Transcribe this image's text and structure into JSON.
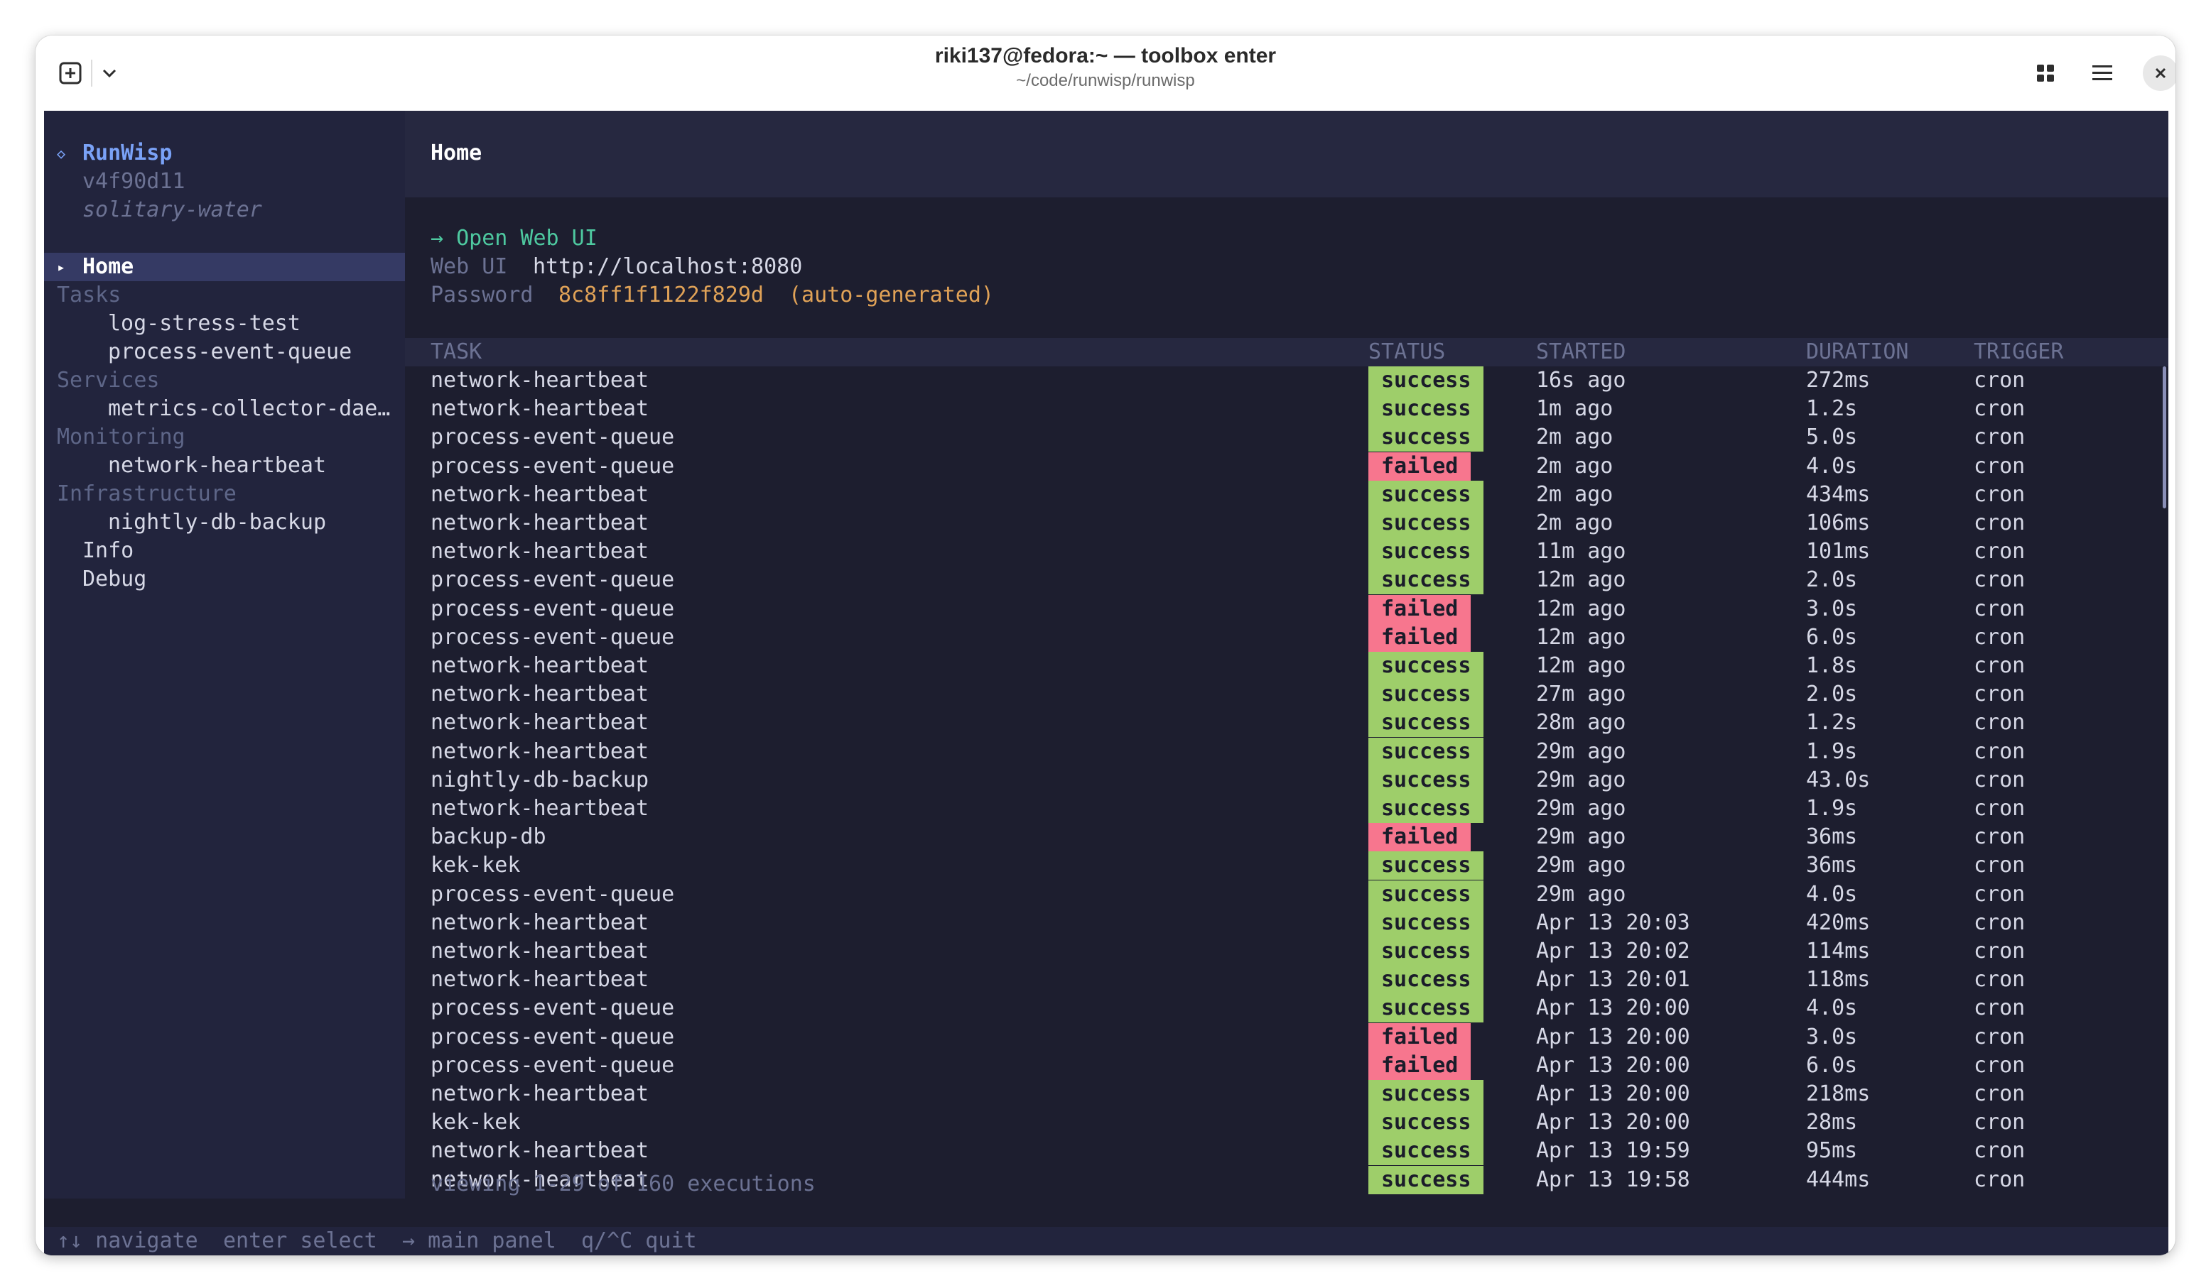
{
  "window": {
    "title": "riki137@fedora:~ — toolbox enter",
    "subtitle": "~/code/runwisp/runwisp"
  },
  "sidebar": {
    "app_name": "RunWisp",
    "app_glyph": "◇",
    "version": "v4f90d11",
    "instance": "solitary-water",
    "home_marker": "▸",
    "home": "Home",
    "sections": {
      "tasks": "Tasks",
      "tasks_items": [
        "log-stress-test",
        "process-event-queue"
      ],
      "services": "Services",
      "services_items": [
        "metrics-collector-dae…"
      ],
      "monitoring": "Monitoring",
      "monitoring_items": [
        "network-heartbeat"
      ],
      "infrastructure": "Infrastructure",
      "infrastructure_items": [
        "nightly-db-backup"
      ]
    },
    "info": "Info",
    "debug": "Debug"
  },
  "main": {
    "title": "Home",
    "open_web_ui": "→  Open Web UI",
    "web_ui_label": "Web UI",
    "web_ui_value": "http://localhost:8080",
    "password_label": "Password",
    "password_value": "8c8ff1f1122f829d",
    "password_note": "(auto-generated)",
    "columns": {
      "task": "TASK",
      "status": "STATUS",
      "started": "STARTED",
      "duration": "DURATION",
      "trigger": "TRIGGER"
    },
    "rows": [
      {
        "task": "network-heartbeat",
        "status": "success",
        "started": "16s ago",
        "duration": "272ms",
        "trigger": "cron"
      },
      {
        "task": "network-heartbeat",
        "status": "success",
        "started": "1m ago",
        "duration": "1.2s",
        "trigger": "cron"
      },
      {
        "task": "process-event-queue",
        "status": "success",
        "started": "2m ago",
        "duration": "5.0s",
        "trigger": "cron"
      },
      {
        "task": "process-event-queue",
        "status": "failed",
        "started": "2m ago",
        "duration": "4.0s",
        "trigger": "cron"
      },
      {
        "task": "network-heartbeat",
        "status": "success",
        "started": "2m ago",
        "duration": "434ms",
        "trigger": "cron"
      },
      {
        "task": "network-heartbeat",
        "status": "success",
        "started": "2m ago",
        "duration": "106ms",
        "trigger": "cron"
      },
      {
        "task": "network-heartbeat",
        "status": "success",
        "started": "11m ago",
        "duration": "101ms",
        "trigger": "cron"
      },
      {
        "task": "process-event-queue",
        "status": "success",
        "started": "12m ago",
        "duration": "2.0s",
        "trigger": "cron"
      },
      {
        "task": "process-event-queue",
        "status": "failed",
        "started": "12m ago",
        "duration": "3.0s",
        "trigger": "cron"
      },
      {
        "task": "process-event-queue",
        "status": "failed",
        "started": "12m ago",
        "duration": "6.0s",
        "trigger": "cron"
      },
      {
        "task": "network-heartbeat",
        "status": "success",
        "started": "12m ago",
        "duration": "1.8s",
        "trigger": "cron"
      },
      {
        "task": "network-heartbeat",
        "status": "success",
        "started": "27m ago",
        "duration": "2.0s",
        "trigger": "cron"
      },
      {
        "task": "network-heartbeat",
        "status": "success",
        "started": "28m ago",
        "duration": "1.2s",
        "trigger": "cron"
      },
      {
        "task": "network-heartbeat",
        "status": "success",
        "started": "29m ago",
        "duration": "1.9s",
        "trigger": "cron"
      },
      {
        "task": "nightly-db-backup",
        "status": "success",
        "started": "29m ago",
        "duration": "43.0s",
        "trigger": "cron"
      },
      {
        "task": "network-heartbeat",
        "status": "success",
        "started": "29m ago",
        "duration": "1.9s",
        "trigger": "cron"
      },
      {
        "task": "backup-db",
        "status": "failed",
        "started": "29m ago",
        "duration": "36ms",
        "trigger": "cron"
      },
      {
        "task": "kek-kek",
        "status": "success",
        "started": "29m ago",
        "duration": "36ms",
        "trigger": "cron"
      },
      {
        "task": "process-event-queue",
        "status": "success",
        "started": "29m ago",
        "duration": "4.0s",
        "trigger": "cron"
      },
      {
        "task": "network-heartbeat",
        "status": "success",
        "started": "Apr 13 20:03",
        "duration": "420ms",
        "trigger": "cron"
      },
      {
        "task": "network-heartbeat",
        "status": "success",
        "started": "Apr 13 20:02",
        "duration": "114ms",
        "trigger": "cron"
      },
      {
        "task": "network-heartbeat",
        "status": "success",
        "started": "Apr 13 20:01",
        "duration": "118ms",
        "trigger": "cron"
      },
      {
        "task": "process-event-queue",
        "status": "success",
        "started": "Apr 13 20:00",
        "duration": "4.0s",
        "trigger": "cron"
      },
      {
        "task": "process-event-queue",
        "status": "failed",
        "started": "Apr 13 20:00",
        "duration": "3.0s",
        "trigger": "cron"
      },
      {
        "task": "process-event-queue",
        "status": "failed",
        "started": "Apr 13 20:00",
        "duration": "6.0s",
        "trigger": "cron"
      },
      {
        "task": "network-heartbeat",
        "status": "success",
        "started": "Apr 13 20:00",
        "duration": "218ms",
        "trigger": "cron"
      },
      {
        "task": "kek-kek",
        "status": "success",
        "started": "Apr 13 20:00",
        "duration": "28ms",
        "trigger": "cron"
      },
      {
        "task": "network-heartbeat",
        "status": "success",
        "started": "Apr 13 19:59",
        "duration": "95ms",
        "trigger": "cron"
      },
      {
        "task": "network-heartbeat",
        "status": "success",
        "started": "Apr 13 19:58",
        "duration": "444ms",
        "trigger": "cron"
      }
    ],
    "footer": "viewing 1-29 of 160 executions"
  },
  "statusbar": {
    "navigate": "↑↓ navigate",
    "select": "enter select",
    "main_panel": "→ main panel",
    "quit": "q/^C quit"
  },
  "colors": {
    "success": "#9ece6a",
    "failed": "#f7768e",
    "accent": "#7aa2f7",
    "link_green": "#4ec9a0",
    "password_orange": "#e0a257"
  }
}
